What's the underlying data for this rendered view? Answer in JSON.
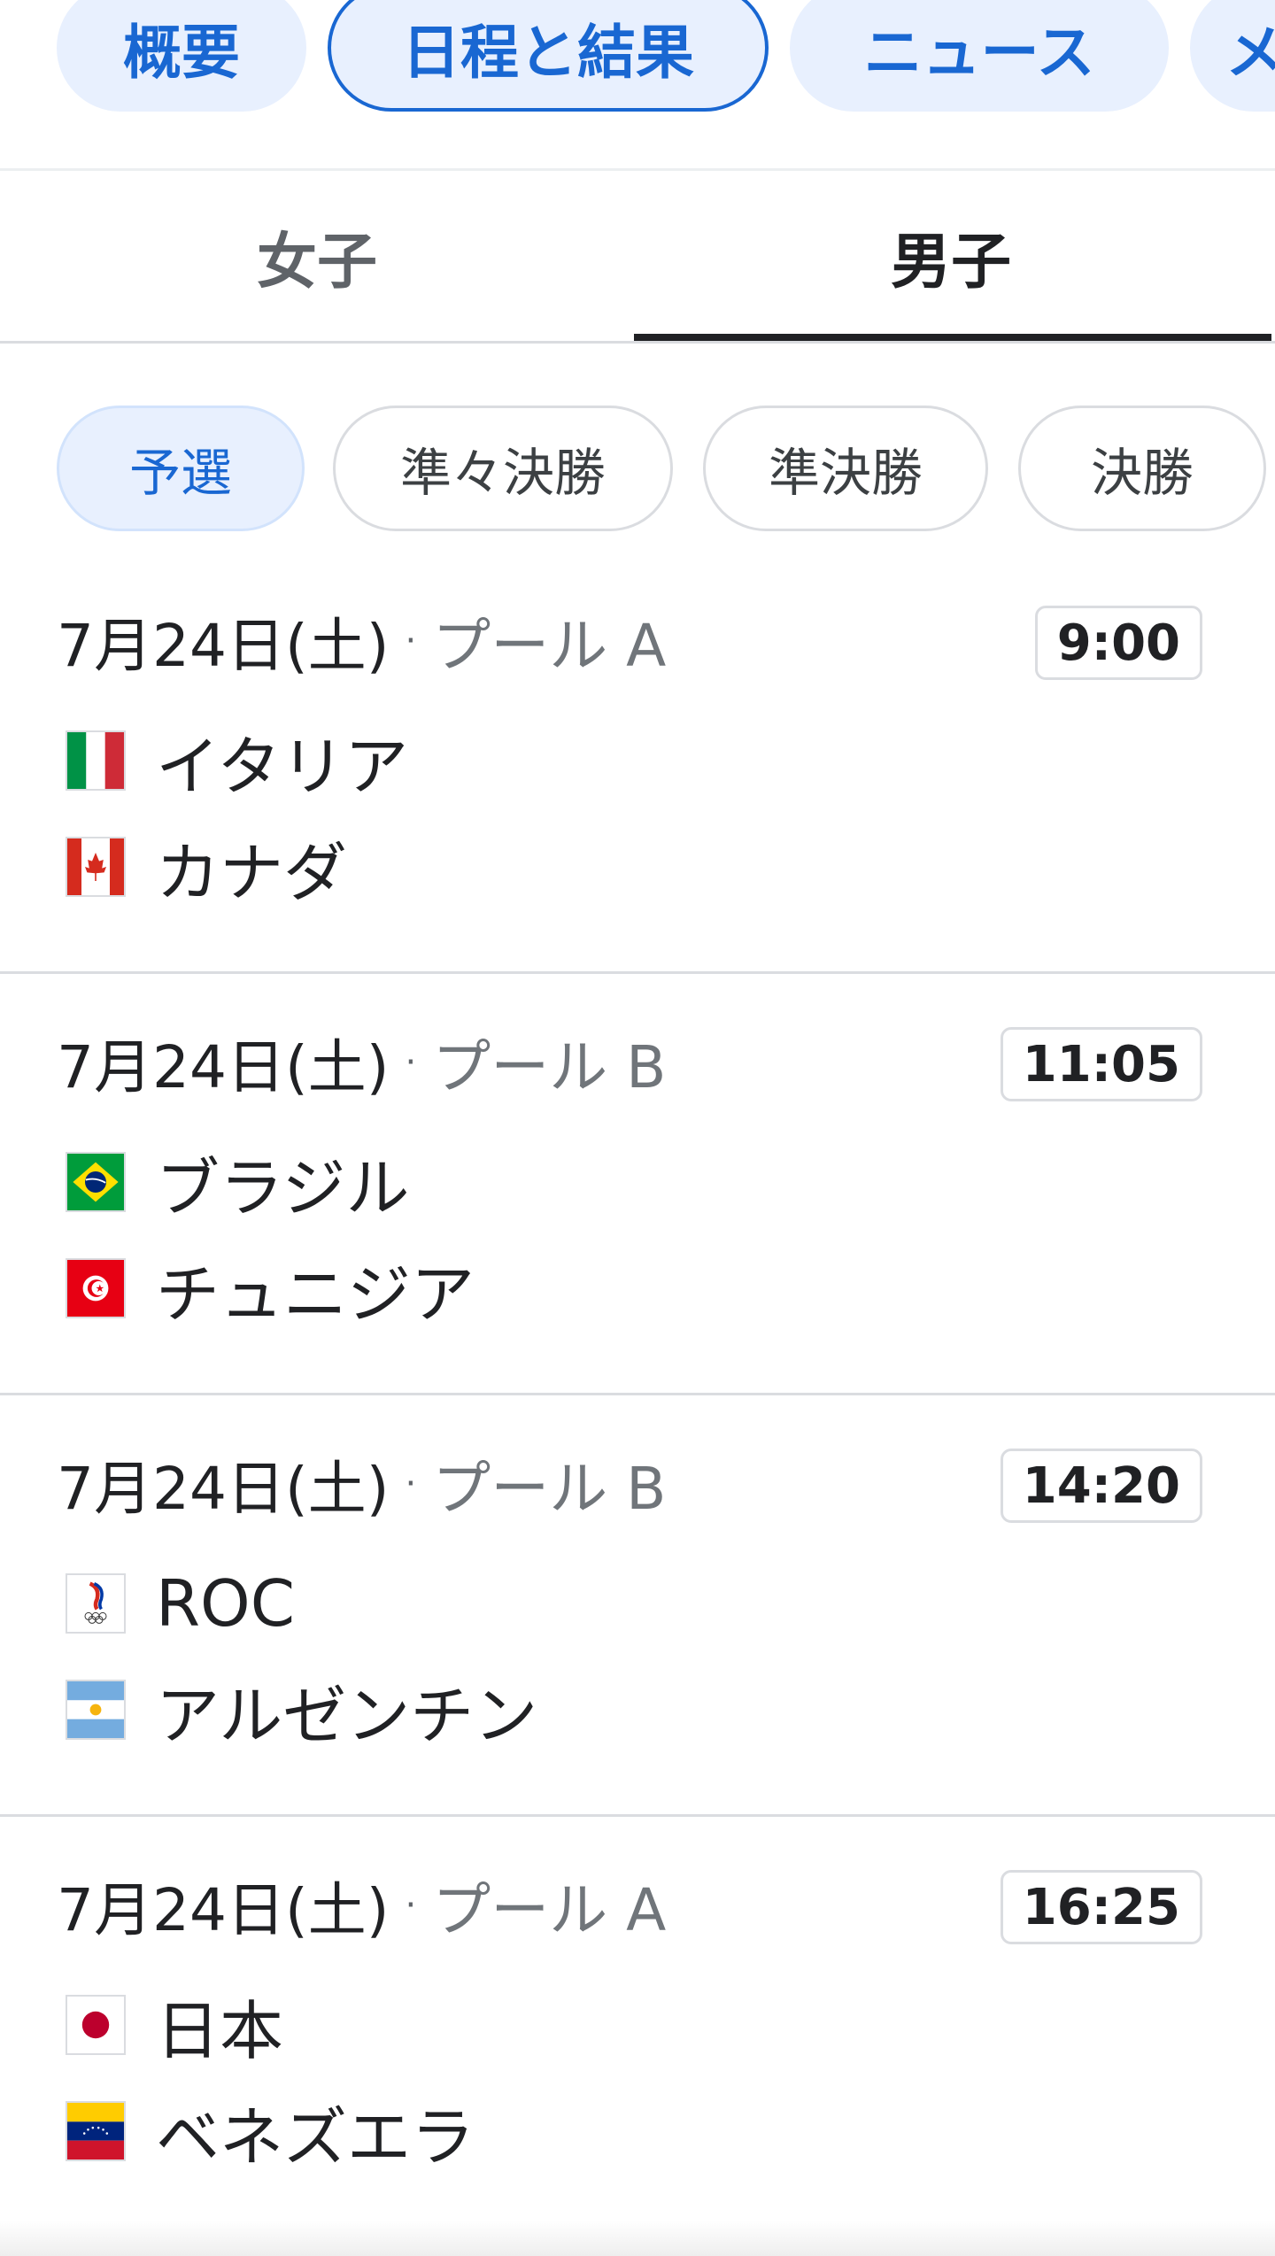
{
  "top_nav": {
    "items": [
      {
        "label": "概要"
      },
      {
        "label": "日程と結果"
      },
      {
        "label": "ニュース"
      },
      {
        "label": "メ"
      }
    ],
    "selected": "日程と結果"
  },
  "gender_tabs": {
    "items": [
      {
        "label": "女子"
      },
      {
        "label": "男子"
      }
    ],
    "selected": "男子"
  },
  "round_filters": {
    "items": [
      {
        "label": "予選"
      },
      {
        "label": "準々決勝"
      },
      {
        "label": "準決勝"
      },
      {
        "label": "決勝"
      }
    ],
    "selected": "予選"
  },
  "matches": [
    {
      "date": "7月24日(土)",
      "separator": "·",
      "pool": "プール A",
      "time": "9:00",
      "teams": [
        {
          "name": "イタリア",
          "flag": "italy-flag-icon"
        },
        {
          "name": "カナダ",
          "flag": "canada-flag-icon"
        }
      ]
    },
    {
      "date": "7月24日(土)",
      "separator": "·",
      "pool": "プール B",
      "time": "11:05",
      "teams": [
        {
          "name": "ブラジル",
          "flag": "brazil-flag-icon"
        },
        {
          "name": "チュニジア",
          "flag": "tunisia-flag-icon"
        }
      ]
    },
    {
      "date": "7月24日(土)",
      "separator": "·",
      "pool": "プール B",
      "time": "14:20",
      "teams": [
        {
          "name": "ROC",
          "flag": "roc-flag-icon"
        },
        {
          "name": "アルゼンチン",
          "flag": "argentina-flag-icon"
        }
      ]
    },
    {
      "date": "7月24日(土)",
      "separator": "·",
      "pool": "プール A",
      "time": "16:25",
      "teams": [
        {
          "name": "日本",
          "flag": "japan-flag-icon"
        },
        {
          "name": "ベネズエラ",
          "flag": "venezuela-flag-icon"
        }
      ]
    }
  ],
  "colors": {
    "accent": "#1967d2",
    "chip_background": "#e8f0fe",
    "divider": "#dadce0",
    "text_primary": "#202124",
    "text_secondary": "#70757a"
  }
}
